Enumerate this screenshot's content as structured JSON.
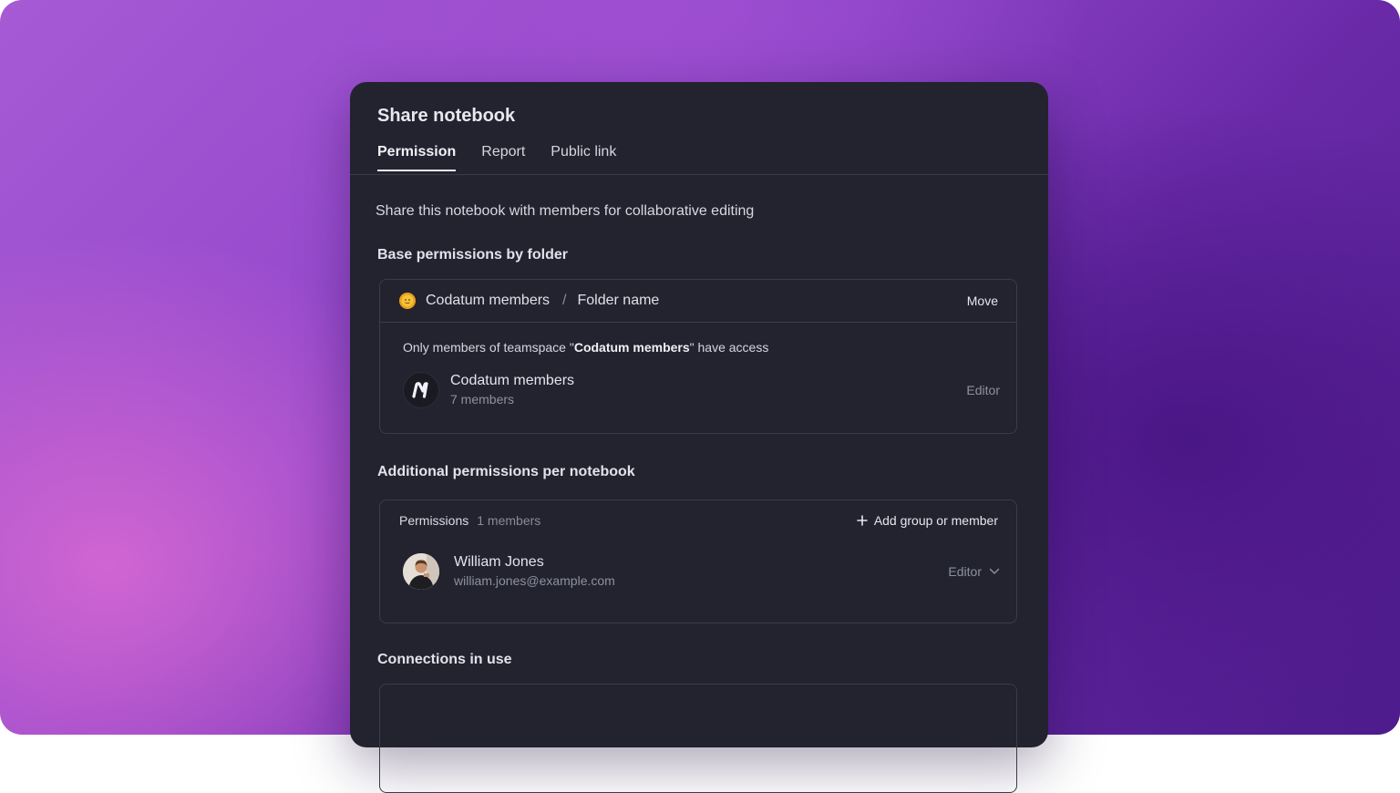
{
  "dialog": {
    "title": "Share notebook",
    "tabs": [
      {
        "label": "Permission",
        "active": true
      },
      {
        "label": "Report",
        "active": false
      },
      {
        "label": "Public link",
        "active": false
      }
    ],
    "intro": "Share this notebook with members for collaborative editing"
  },
  "base_permissions": {
    "heading": "Base permissions by folder",
    "folder_icon": "sun-icon",
    "teamspace": "Codatum members",
    "separator": "/",
    "folder": "Folder name",
    "move_label": "Move",
    "access_note_prefix": "Only members of teamspace \"",
    "access_note_team": "Codatum members",
    "access_note_suffix": "\" have access",
    "team_member": {
      "avatar_icon": "codatum-logo-icon",
      "name": "Codatum members",
      "sub": "7 members",
      "role": "Editor"
    }
  },
  "additional_permissions": {
    "heading": "Additional permissions per notebook",
    "title": "Permissions",
    "count": "1 members",
    "add_label": "Add group or member",
    "members": [
      {
        "name": "William Jones",
        "email": "william.jones@example.com",
        "role": "Editor"
      }
    ]
  },
  "connections": {
    "heading": "Connections in use"
  },
  "colors": {
    "dialog_bg": "#22232f",
    "border": "#3b3c49",
    "muted_text": "#8f90a0",
    "backdrop_accent": "#9448cc"
  }
}
